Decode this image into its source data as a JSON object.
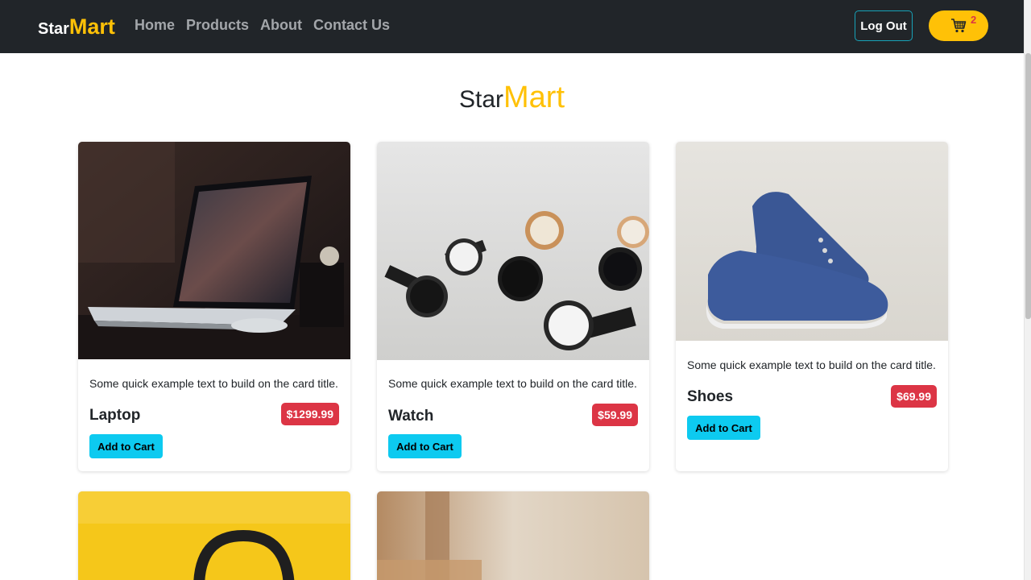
{
  "navbar": {
    "brand": {
      "star": "Star",
      "mart": "Mart"
    },
    "links": [
      "Home",
      "Products",
      "About",
      "Contact Us"
    ],
    "logout_label": "Log Out",
    "cart_count": "2",
    "cart_icon": "shopping-cart-icon"
  },
  "page_title": {
    "star": "Star",
    "mart": "Mart"
  },
  "products": [
    {
      "name": "Laptop",
      "text": "Some quick example text to build on the card title.",
      "price": "$1299.99",
      "button": "Add to Cart",
      "image": "laptop-photo"
    },
    {
      "name": "Watch",
      "text": "Some quick example text to build on the card title.",
      "price": "$59.99",
      "button": "Add to Cart",
      "image": "watches-photo"
    },
    {
      "name": "Shoes",
      "text": "Some quick example text to build on the card title.",
      "price": "$69.99",
      "button": "Add to Cart",
      "image": "shoes-photo"
    },
    {
      "image": "headphones-photo"
    },
    {
      "image": "product-photo"
    }
  ],
  "colors": {
    "navbar_bg": "#212529",
    "accent_yellow": "#ffc107",
    "price_red": "#dc3545",
    "button_cyan": "#0dcaf0",
    "outline_teal": "#17a2b8"
  }
}
